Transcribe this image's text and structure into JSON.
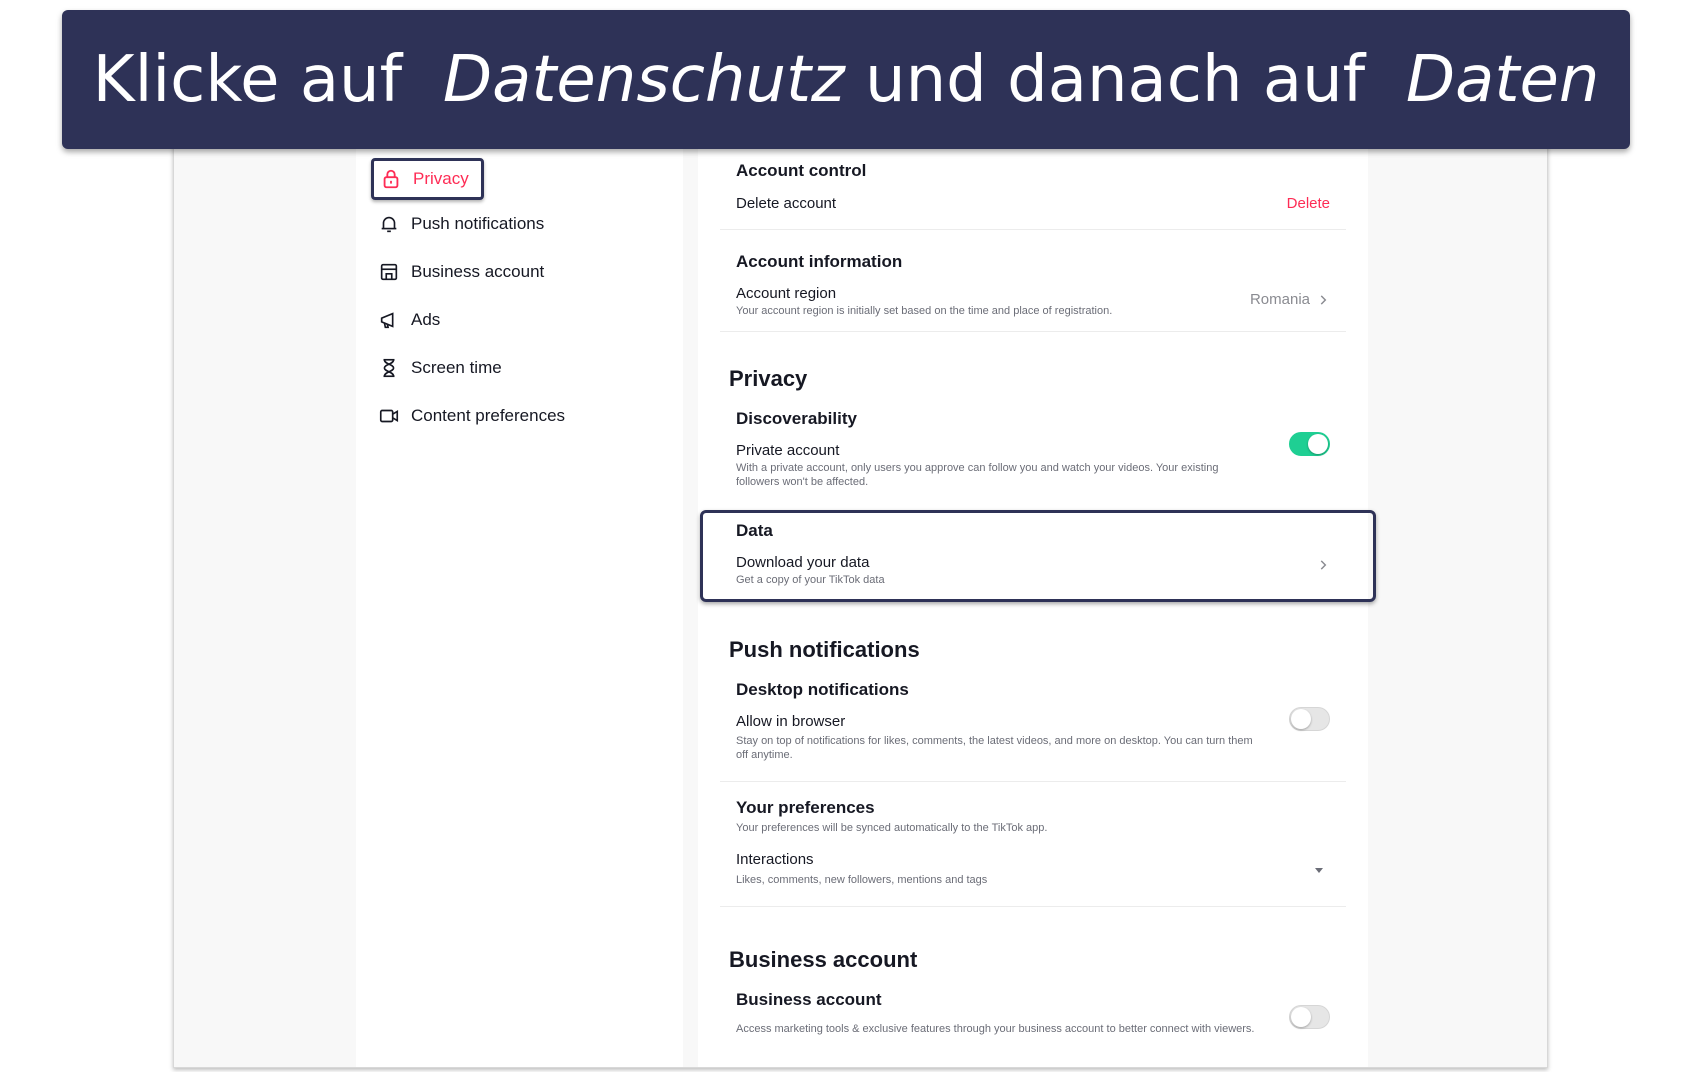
{
  "banner": {
    "part1": "Klicke auf",
    "part2": "Datenschutz",
    "part3": "und danach auf",
    "part4": "Daten"
  },
  "sidebar": {
    "items": [
      {
        "label": "Privacy",
        "icon": "lock-icon",
        "active": true
      },
      {
        "label": "Push notifications",
        "icon": "bell-icon"
      },
      {
        "label": "Business account",
        "icon": "store-icon"
      },
      {
        "label": "Ads",
        "icon": "megaphone-icon"
      },
      {
        "label": "Screen time",
        "icon": "hourglass-icon"
      },
      {
        "label": "Content preferences",
        "icon": "video-icon"
      }
    ]
  },
  "account": {
    "control_title": "Account control",
    "delete_label": "Delete account",
    "delete_action": "Delete",
    "info_title": "Account information",
    "region_label": "Account region",
    "region_desc": "Your account region is initially set based on the time and place of registration.",
    "region_value": "Romania"
  },
  "privacy": {
    "title": "Privacy",
    "discoverability_title": "Discoverability",
    "private_label": "Private account",
    "private_desc": "With a private account, only users you approve can follow you and watch your videos. Your existing followers won't be affected.",
    "private_on": true,
    "data_title": "Data",
    "download_label": "Download your data",
    "download_desc": "Get a copy of your TikTok data"
  },
  "push": {
    "title": "Push notifications",
    "desktop_title": "Desktop notifications",
    "allow_label": "Allow in browser",
    "allow_desc": "Stay on top of notifications for likes, comments, the latest videos, and more on desktop. You can turn them off anytime.",
    "allow_on": false,
    "prefs_title": "Your preferences",
    "prefs_desc": "Your preferences will be synced automatically to the TikTok app.",
    "interactions_label": "Interactions",
    "interactions_desc": "Likes, comments, new followers, mentions and tags"
  },
  "business": {
    "title": "Business account",
    "row_label": "Business account",
    "row_desc": "Access marketing tools & exclusive features through your business account to better connect with viewers.",
    "on": false
  },
  "colors": {
    "banner_bg": "#2e3257",
    "accent": "#fe2c55",
    "toggle_on": "#1fcf93"
  }
}
